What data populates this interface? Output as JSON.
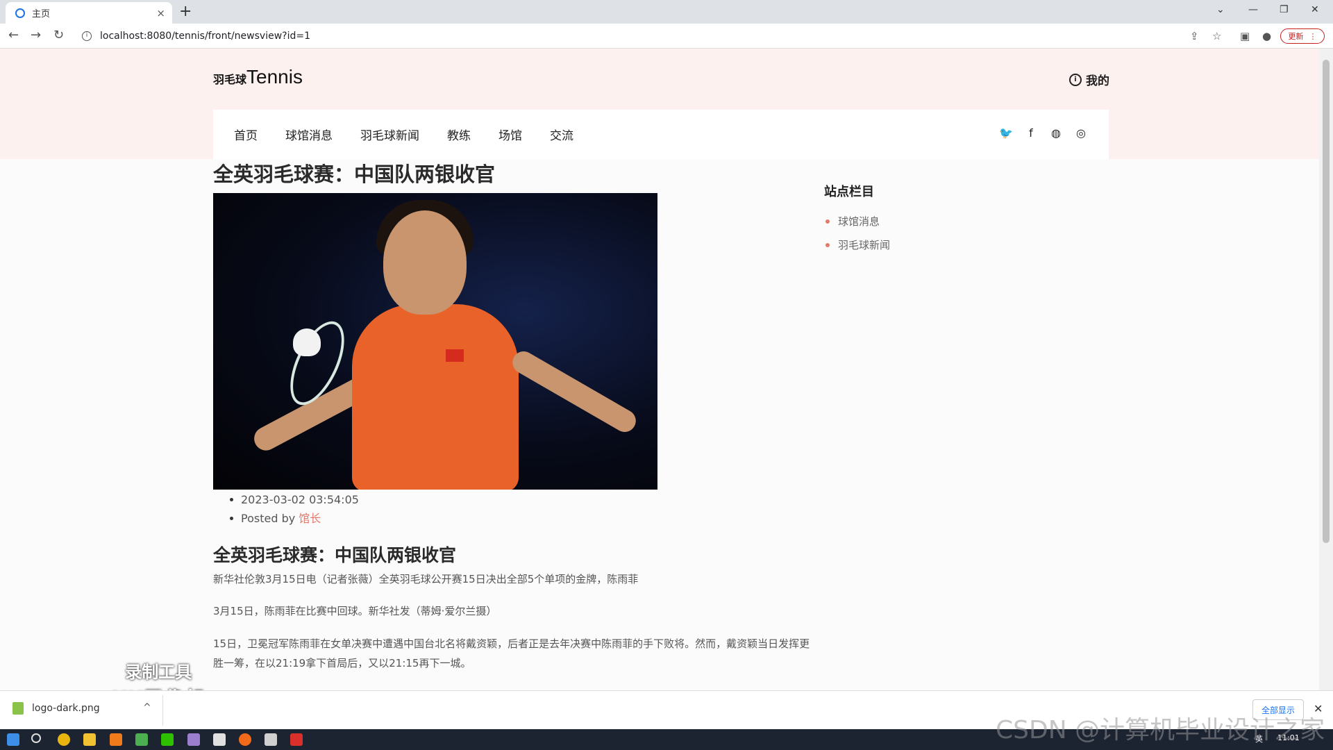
{
  "browser": {
    "tab_title": "主页",
    "tab_close": "×",
    "new_tab": "+",
    "url": "localhost:8080/tennis/front/newsview?id=1",
    "update_label": "更新",
    "update_more": "⋮",
    "back": "←",
    "forward": "→",
    "reload": "↻",
    "tab_list": "⌄",
    "minimize": "—",
    "restore": "❐",
    "close": "✕",
    "share": "⇪",
    "bookmark": "☆",
    "sidepanel": "▣",
    "profile": "●"
  },
  "site": {
    "logo_small": "羽毛球",
    "logo_big": "Tennis",
    "mine_label": "我的",
    "mine_icon": "i",
    "nav": [
      "首页",
      "球馆消息",
      "羽毛球新闻",
      "教练",
      "场馆",
      "交流"
    ],
    "social": [
      {
        "name": "twitter-icon",
        "glyph": "🐦"
      },
      {
        "name": "facebook-icon",
        "glyph": "f"
      },
      {
        "name": "dribbble-icon",
        "glyph": "◍"
      },
      {
        "name": "instagram-icon",
        "glyph": "◎"
      }
    ]
  },
  "article": {
    "title": "全英羽毛球赛：中国队两银收官",
    "date": "2023-03-02 03:54:05",
    "posted_by_label": "Posted by",
    "author": "馆长",
    "subtitle": "全英羽毛球赛：中国队两银收官",
    "paragraphs": [
      "新华社伦敦3月15日电（记者张薇）全英羽毛球公开赛15日决出全部5个单项的金牌，陈雨菲",
      "3月15日，陈雨菲在比赛中回球。新华社发（蒂姆·爱尔兰摄）",
      "15日，卫冕冠军陈雨菲在女单决赛中遭遇中国台北名将戴资颖，后者正是去年决赛中陈雨菲的手下败将。然而，戴资颖当日发挥更胜一筹，在以21:19拿下首局后，又以21:15再下一城。"
    ]
  },
  "sidebar": {
    "title": "站点栏目",
    "items": [
      "球馆消息",
      "羽毛球新闻"
    ]
  },
  "watermark": {
    "line1": "录制工具",
    "line2": "KK录像机",
    "csdn": "CSDN @计算机毕业设计之家"
  },
  "downloads": {
    "file": "logo-dark.png",
    "chevron": "^",
    "show_all": "全部显示",
    "close": "✕"
  },
  "taskbar": {
    "time": "11:01",
    "lang": "英"
  }
}
